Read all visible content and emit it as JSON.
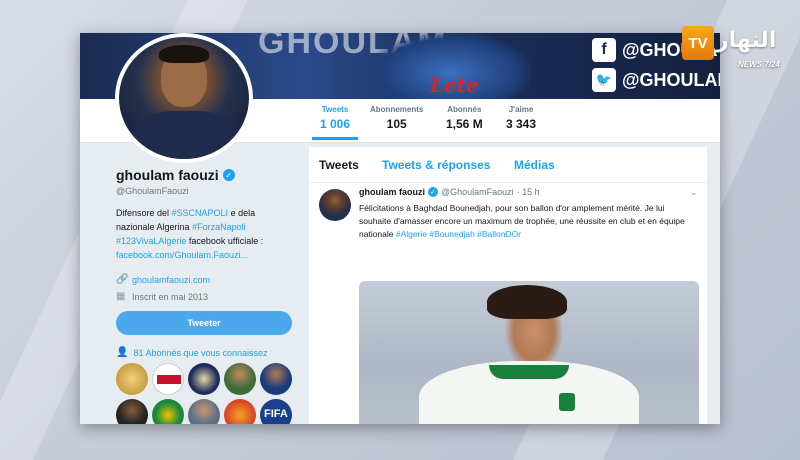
{
  "banner": {
    "text": "GHOULAM",
    "shirt_text": "Lete",
    "social": [
      {
        "icon": "facebook-icon",
        "glyph": "f",
        "handle": "@GHOULA"
      },
      {
        "icon": "twitter-icon",
        "glyph": "🐦",
        "handle": "@GHOULAM"
      }
    ]
  },
  "stats": [
    {
      "label": "Tweets",
      "value": "1 006",
      "active": true
    },
    {
      "label": "Abonnements",
      "value": "105",
      "active": false
    },
    {
      "label": "Abonnés",
      "value": "1,56 M",
      "active": false
    },
    {
      "label": "J'aime",
      "value": "3 343",
      "active": false
    }
  ],
  "profile": {
    "name": "ghoulam faouzi",
    "handle": "@GhoulamFaouzi",
    "bio_plain_1": "Difensore del ",
    "bio_tag_1": "#SSCNAPOLI",
    "bio_plain_2": " e dela nazionale Algerina ",
    "bio_tag_2": "#ForzaNapoli",
    "bio_tag_3": "#123VivaLAlgerie",
    "bio_plain_3": " facebook ufficiale : ",
    "bio_link": "facebook.com/Ghoulam.Faouzi...",
    "website": "ghoulamfaouzi.com",
    "joined": "Inscrit en mai 2013",
    "follow_button": "Tweeter",
    "mutual_followers": "81 Abonnés que vous connaissez"
  },
  "timeline": {
    "tabs": [
      "Tweets",
      "Tweets & réponses",
      "Médias"
    ],
    "tweet": {
      "author": "ghoulam faouzi",
      "handle": "@GhoulamFaouzi",
      "time": "· 15 h",
      "text_1": "Félicitations à Baghdad Bounedjah, pour son ballon d'or amplement mérité. Je lui souhaite d'amasser encore un maximum de trophée, une réussite en club et en équipe nationale ",
      "hashtags": "#Algerie #Bounedjah #BallonDOr"
    }
  },
  "channel_logo": {
    "tv": "TV",
    "arabic": "النهار",
    "tagline": "NEWS 7/24"
  },
  "colors": {
    "accent": "#1da1f2",
    "banner": "#1a2b52",
    "logo_orange": "#f9a61a"
  }
}
